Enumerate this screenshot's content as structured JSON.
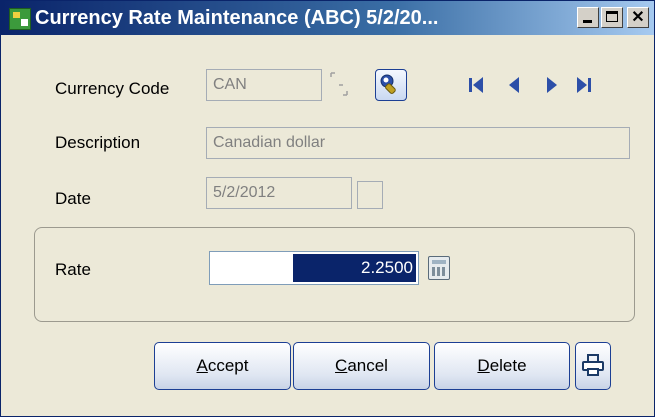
{
  "window": {
    "title": "Currency Rate Maintenance (ABC) 5/2/20...",
    "close_glyph": "✕"
  },
  "form": {
    "currency_code": {
      "label": "Currency Code",
      "value": "CAN"
    },
    "description": {
      "label": "Description",
      "value": "Canadian dollar"
    },
    "date": {
      "label": "Date",
      "value": "5/2/2012"
    },
    "rate": {
      "label": "Rate",
      "value": "2.2500"
    }
  },
  "navigation": {
    "icons": [
      "first-record-icon",
      "previous-record-icon",
      "next-record-icon",
      "last-record-icon"
    ]
  },
  "buttons": {
    "accept": {
      "first": "A",
      "rest": "ccept"
    },
    "cancel": {
      "first": "C",
      "rest": "ancel"
    },
    "delete": {
      "first": "D",
      "rest": "elete"
    }
  },
  "colors": {
    "titlebar_start": "#0a246a",
    "selection": "#0a246a",
    "nav_icons": "#2c4fa8",
    "button_border": "#1c3f94",
    "window_bg": "#ece9d8"
  }
}
